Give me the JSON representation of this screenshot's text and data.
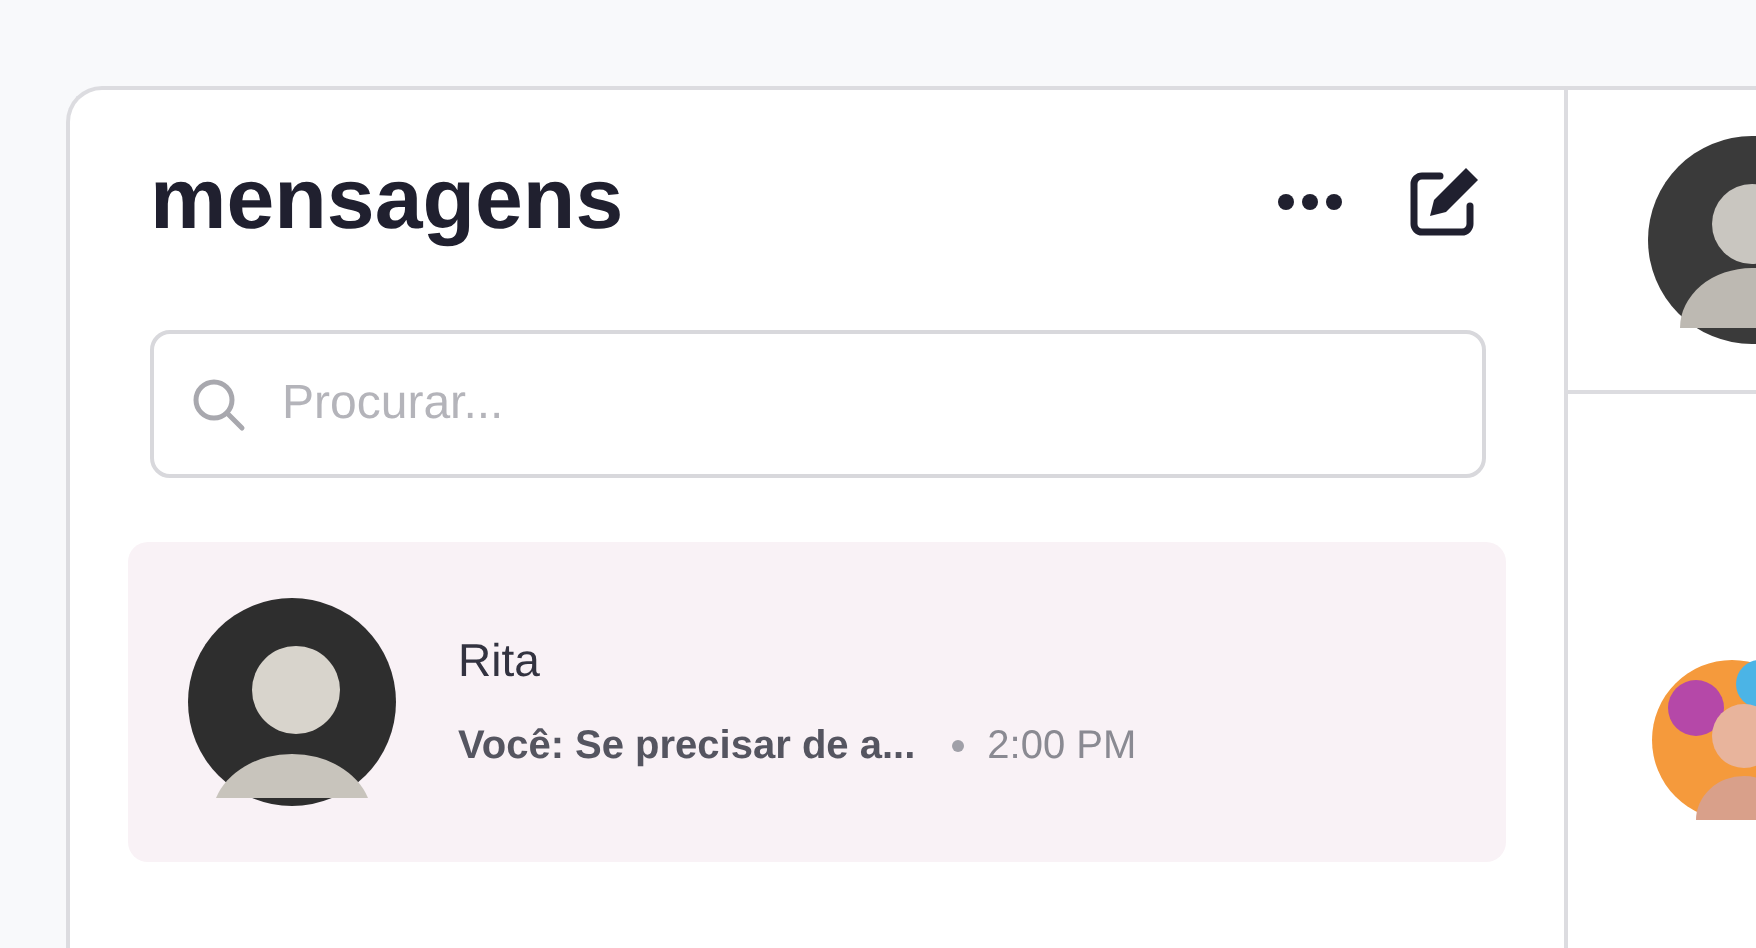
{
  "sidebar": {
    "title": "mensagens",
    "search": {
      "placeholder": "Procurar..."
    },
    "conversations": [
      {
        "name": "Rita",
        "preview": "Você: Se precisar de a...",
        "time": "2:00 PM",
        "selected": true
      }
    ]
  }
}
